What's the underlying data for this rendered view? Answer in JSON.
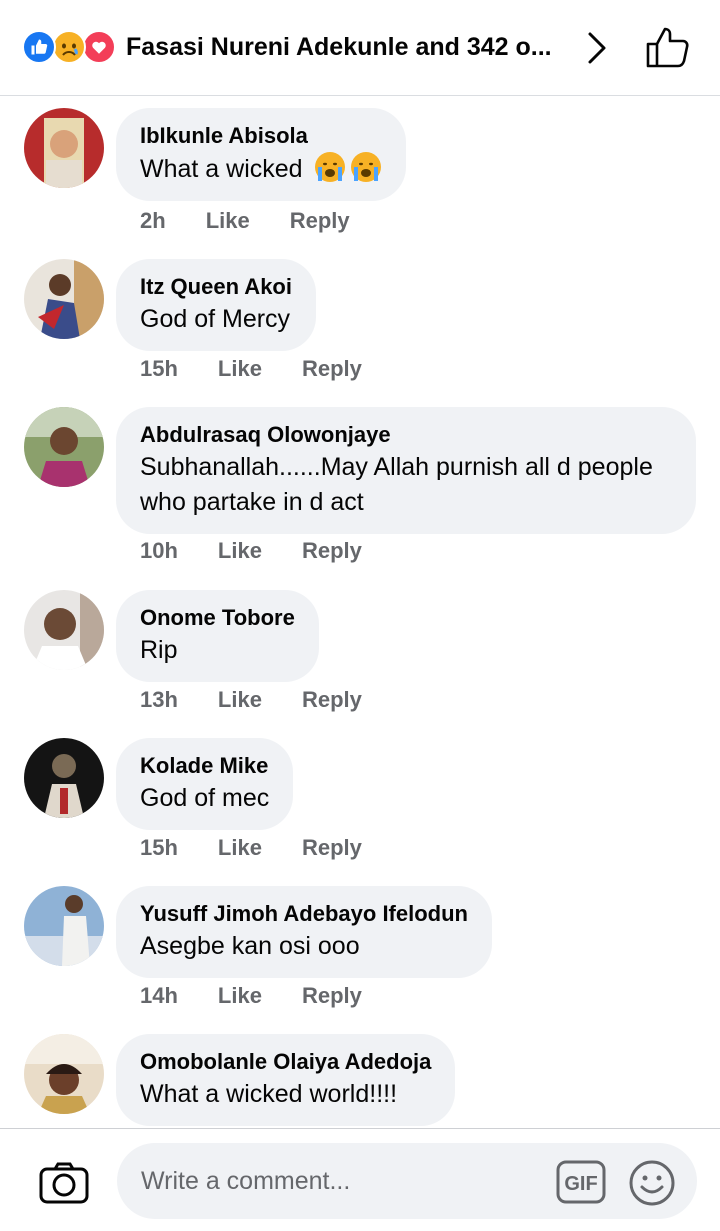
{
  "header": {
    "title": "Fasasi Nureni Adekunle and 342 o...",
    "reactions": [
      "like-reaction",
      "sad-reaction",
      "love-reaction"
    ]
  },
  "comments": [
    {
      "author": "IbIkunle Abisola",
      "text": "What a wicked",
      "emoji": [
        "crying-face",
        "crying-face"
      ],
      "time": "2h",
      "like": "Like",
      "reply": "Reply"
    },
    {
      "author": "Itz Queen Akoi",
      "text": "God of Mercy",
      "time": "15h",
      "like": "Like",
      "reply": "Reply"
    },
    {
      "author": "Abdulrasaq Olowonjaye",
      "text": "Subhanallah......May Allah purnish all d people who partake in d act",
      "time": "10h",
      "like": "Like",
      "reply": "Reply"
    },
    {
      "author": "Onome Tobore",
      "text": "Rip",
      "time": "13h",
      "like": "Like",
      "reply": "Reply"
    },
    {
      "author": "Kolade Mike",
      "text": "God of mec",
      "time": "15h",
      "like": "Like",
      "reply": "Reply"
    },
    {
      "author": "Yusuff Jimoh Adebayo Ifelodun",
      "text": "Asegbe kan osi ooo",
      "time": "14h",
      "like": "Like",
      "reply": "Reply"
    },
    {
      "author": "Omobolanle Olaiya Adedoja",
      "text": "What a wicked world!!!!"
    }
  ],
  "composer": {
    "placeholder": "Write a comment...",
    "gif_label": "GIF"
  },
  "colors": {
    "bubble": "#f0f2f5",
    "meta": "#65676b",
    "like_blue": "#1877f2",
    "love_red": "#f33e58",
    "sad_yellow": "#f7b125"
  }
}
